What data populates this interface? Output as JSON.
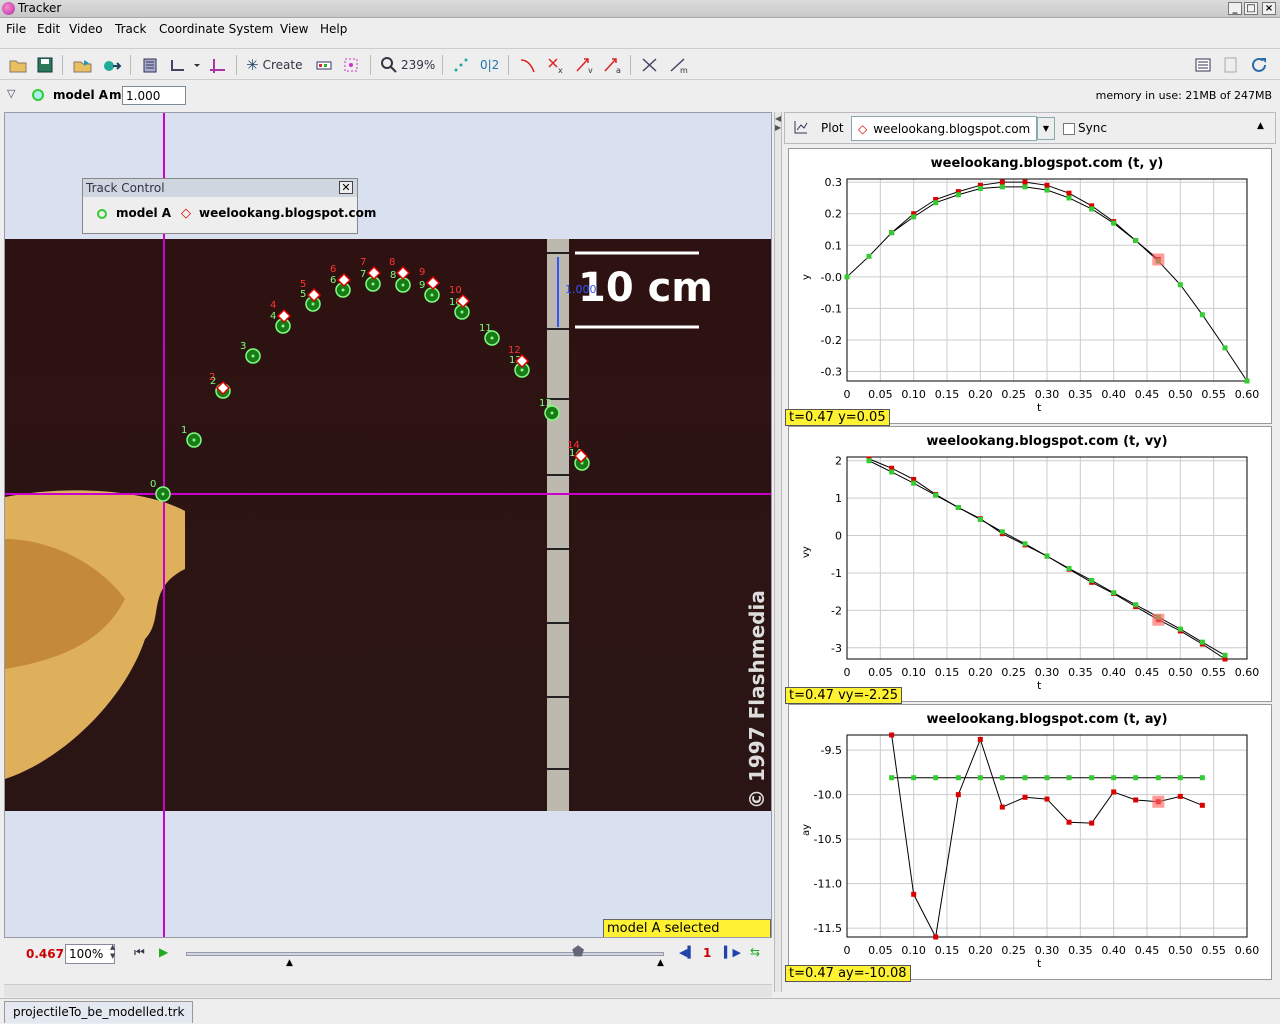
{
  "window": {
    "title": "Tracker",
    "buttons": [
      "_",
      "□",
      "×"
    ]
  },
  "menu": [
    "File",
    "Edit",
    "Video",
    "Track",
    "Coordinate System",
    "View",
    "Help"
  ],
  "toolbar": {
    "create_label": "Create",
    "zoom_label": "239%",
    "coord_label": "0|2"
  },
  "trackbar": {
    "track_name": "model A",
    "mass_label": "m",
    "mass_value": "1.000",
    "memory": "memory in use: 21MB of 247MB"
  },
  "video": {
    "scale_label": "10 cm",
    "scale_readout": "1.000",
    "watermark": "© 1997 Flashmedia",
    "status": "model A selected (locked)",
    "colors": {
      "axis": "#cc00cc",
      "model": "#33cc33",
      "data": "#dd0000"
    },
    "green_points": [
      {
        "n": "0",
        "tx": 162,
        "ty": 493
      },
      {
        "n": "1",
        "tx": 193,
        "ty": 439
      },
      {
        "n": "2",
        "tx": 222,
        "ty": 390
      },
      {
        "n": "3",
        "tx": 252,
        "ty": 355
      },
      {
        "n": "4",
        "tx": 282,
        "ty": 325
      },
      {
        "n": "5",
        "tx": 312,
        "ty": 303
      },
      {
        "n": "6",
        "tx": 342,
        "ty": 289
      },
      {
        "n": "7",
        "tx": 372,
        "ty": 283
      },
      {
        "n": "8",
        "tx": 402,
        "ty": 284
      },
      {
        "n": "9",
        "tx": 431,
        "ty": 294
      },
      {
        "n": "10",
        "tx": 461,
        "ty": 311
      },
      {
        "n": "11",
        "tx": 491,
        "ty": 337
      },
      {
        "n": "12",
        "tx": 521,
        "ty": 369
      },
      {
        "n": "13",
        "tx": 551,
        "ty": 412
      },
      {
        "n": "14",
        "tx": 581,
        "ty": 462
      }
    ],
    "red_points": [
      {
        "n": "2",
        "tx": 222,
        "ty": 387
      },
      {
        "n": "4",
        "tx": 283,
        "ty": 315
      },
      {
        "n": "5",
        "tx": 313,
        "ty": 294
      },
      {
        "n": "6",
        "tx": 343,
        "ty": 279
      },
      {
        "n": "7",
        "tx": 373,
        "ty": 272
      },
      {
        "n": "8",
        "tx": 402,
        "ty": 272
      },
      {
        "n": "9",
        "tx": 432,
        "ty": 282
      },
      {
        "n": "10",
        "tx": 462,
        "ty": 300
      },
      {
        "n": "12",
        "tx": 521,
        "ty": 360
      },
      {
        "n": "14",
        "tx": 580,
        "ty": 455
      }
    ]
  },
  "track_control": {
    "title": "Track Control",
    "model": "model A",
    "data": "weelookang.blogspot.com"
  },
  "player": {
    "time": "0.467",
    "speed": "100%",
    "frame": "1"
  },
  "plot_panel": {
    "label": "Plot",
    "track": "weelookang.blogspot.com",
    "sync": "Sync"
  },
  "plots": [
    {
      "title": "weelookang.blogspot.com (t, y)",
      "ylabel": "y",
      "xlabel": "t",
      "readout": "t=0.47  y=0.05",
      "xticks": [
        "0",
        "0.05",
        "0.10",
        "0.15",
        "0.20",
        "0.25",
        "0.30",
        "0.35",
        "0.40",
        "0.45",
        "0.50",
        "0.55",
        "0.60"
      ],
      "yticks": [
        "0.3",
        "0.2",
        "0.1",
        "-0.0",
        "-0.1",
        "-0.2",
        "-0.3"
      ],
      "ytickvals": [
        0.3,
        0.2,
        0.1,
        0,
        -0.1,
        -0.2,
        -0.3
      ],
      "xlim": [
        0,
        0.6
      ],
      "ylim": [
        -0.33,
        0.31
      ],
      "series": [
        {
          "color": "#dd0000",
          "t": [
            0.067,
            0.1,
            0.133,
            0.167,
            0.2,
            0.233,
            0.267,
            0.3,
            0.333,
            0.367,
            0.4,
            0.433,
            0.467
          ],
          "v": [
            0.14,
            0.2,
            0.245,
            0.27,
            0.29,
            0.3,
            0.3,
            0.29,
            0.265,
            0.225,
            0.175,
            0.115,
            0.055
          ]
        },
        {
          "color": "#33cc33",
          "t": [
            0,
            0.033,
            0.067,
            0.1,
            0.133,
            0.167,
            0.2,
            0.233,
            0.267,
            0.3,
            0.333,
            0.367,
            0.4,
            0.433,
            0.467,
            0.5,
            0.533,
            0.567,
            0.6
          ],
          "v": [
            0,
            0.065,
            0.14,
            0.19,
            0.235,
            0.26,
            0.28,
            0.285,
            0.285,
            0.275,
            0.25,
            0.215,
            0.17,
            0.115,
            0.05,
            -0.025,
            -0.12,
            -0.225,
            -0.33
          ]
        }
      ],
      "highlight": {
        "t": 0.467,
        "v": 0.055
      }
    },
    {
      "title": "weelookang.blogspot.com (t, vy)",
      "ylabel": "vy",
      "xlabel": "t",
      "readout": "t=0.47  vy=-2.25",
      "xticks": [
        "0",
        "0.05",
        "0.10",
        "0.15",
        "0.20",
        "0.25",
        "0.30",
        "0.35",
        "0.40",
        "0.45",
        "0.50",
        "0.55",
        "0.60"
      ],
      "yticks": [
        "2",
        "1",
        "0",
        "-1",
        "-2",
        "-3"
      ],
      "ytickvals": [
        2,
        1,
        0,
        -1,
        -2,
        -3
      ],
      "xlim": [
        0,
        0.6
      ],
      "ylim": [
        -3.3,
        2.1
      ],
      "series": [
        {
          "color": "#dd0000",
          "t": [
            0.033,
            0.067,
            0.1,
            0.133,
            0.167,
            0.2,
            0.233,
            0.267,
            0.3,
            0.333,
            0.367,
            0.4,
            0.433,
            0.467,
            0.5,
            0.533,
            0.567
          ],
          "v": [
            2.05,
            1.8,
            1.5,
            1.1,
            0.75,
            0.45,
            0.05,
            -0.25,
            -0.55,
            -0.9,
            -1.25,
            -1.55,
            -1.9,
            -2.25,
            -2.55,
            -2.9,
            -3.3
          ]
        },
        {
          "color": "#33cc33",
          "t": [
            0.033,
            0.067,
            0.1,
            0.133,
            0.167,
            0.2,
            0.233,
            0.267,
            0.3,
            0.333,
            0.367,
            0.4,
            0.433,
            0.467,
            0.5,
            0.533,
            0.567
          ],
          "v": [
            2.0,
            1.7,
            1.4,
            1.08,
            0.75,
            0.43,
            0.1,
            -0.22,
            -0.55,
            -0.88,
            -1.2,
            -1.53,
            -1.85,
            -2.18,
            -2.5,
            -2.85,
            -3.2
          ]
        }
      ],
      "highlight": {
        "t": 0.467,
        "v": -2.25
      }
    },
    {
      "title": "weelookang.blogspot.com (t, ay)",
      "ylabel": "ay",
      "xlabel": "t",
      "readout": "t=0.47  ay=-10.08",
      "xticks": [
        "0",
        "0.05",
        "0.10",
        "0.15",
        "0.20",
        "0.25",
        "0.30",
        "0.35",
        "0.40",
        "0.45",
        "0.50",
        "0.55",
        "0.60"
      ],
      "yticks": [
        "-9.5",
        "-10.0",
        "-10.5",
        "-11.0",
        "-11.5"
      ],
      "ytickvals": [
        -9.5,
        -10,
        -10.5,
        -11,
        -11.5
      ],
      "xlim": [
        0,
        0.6
      ],
      "ylim": [
        -11.6,
        -9.33
      ],
      "series": [
        {
          "color": "#dd0000",
          "t": [
            0.067,
            0.1,
            0.133,
            0.167,
            0.2,
            0.233,
            0.267,
            0.3,
            0.333,
            0.367,
            0.4,
            0.433,
            0.467,
            0.5,
            0.533
          ],
          "v": [
            -9.33,
            -11.12,
            -11.6,
            -10.0,
            -9.38,
            -10.14,
            -10.03,
            -10.05,
            -10.31,
            -10.32,
            -9.97,
            -10.06,
            -10.08,
            -10.02,
            -10.12
          ]
        },
        {
          "color": "#33cc33",
          "t": [
            0.067,
            0.1,
            0.133,
            0.167,
            0.2,
            0.233,
            0.267,
            0.3,
            0.333,
            0.367,
            0.4,
            0.433,
            0.467,
            0.5,
            0.533
          ],
          "v": [
            -9.81,
            -9.81,
            -9.81,
            -9.81,
            -9.81,
            -9.81,
            -9.81,
            -9.81,
            -9.81,
            -9.81,
            -9.81,
            -9.81,
            -9.81,
            -9.81,
            -9.81
          ]
        }
      ],
      "highlight": {
        "t": 0.467,
        "v": -10.08
      }
    }
  ],
  "file_tab": "projectileTo_be_modelled.trk"
}
